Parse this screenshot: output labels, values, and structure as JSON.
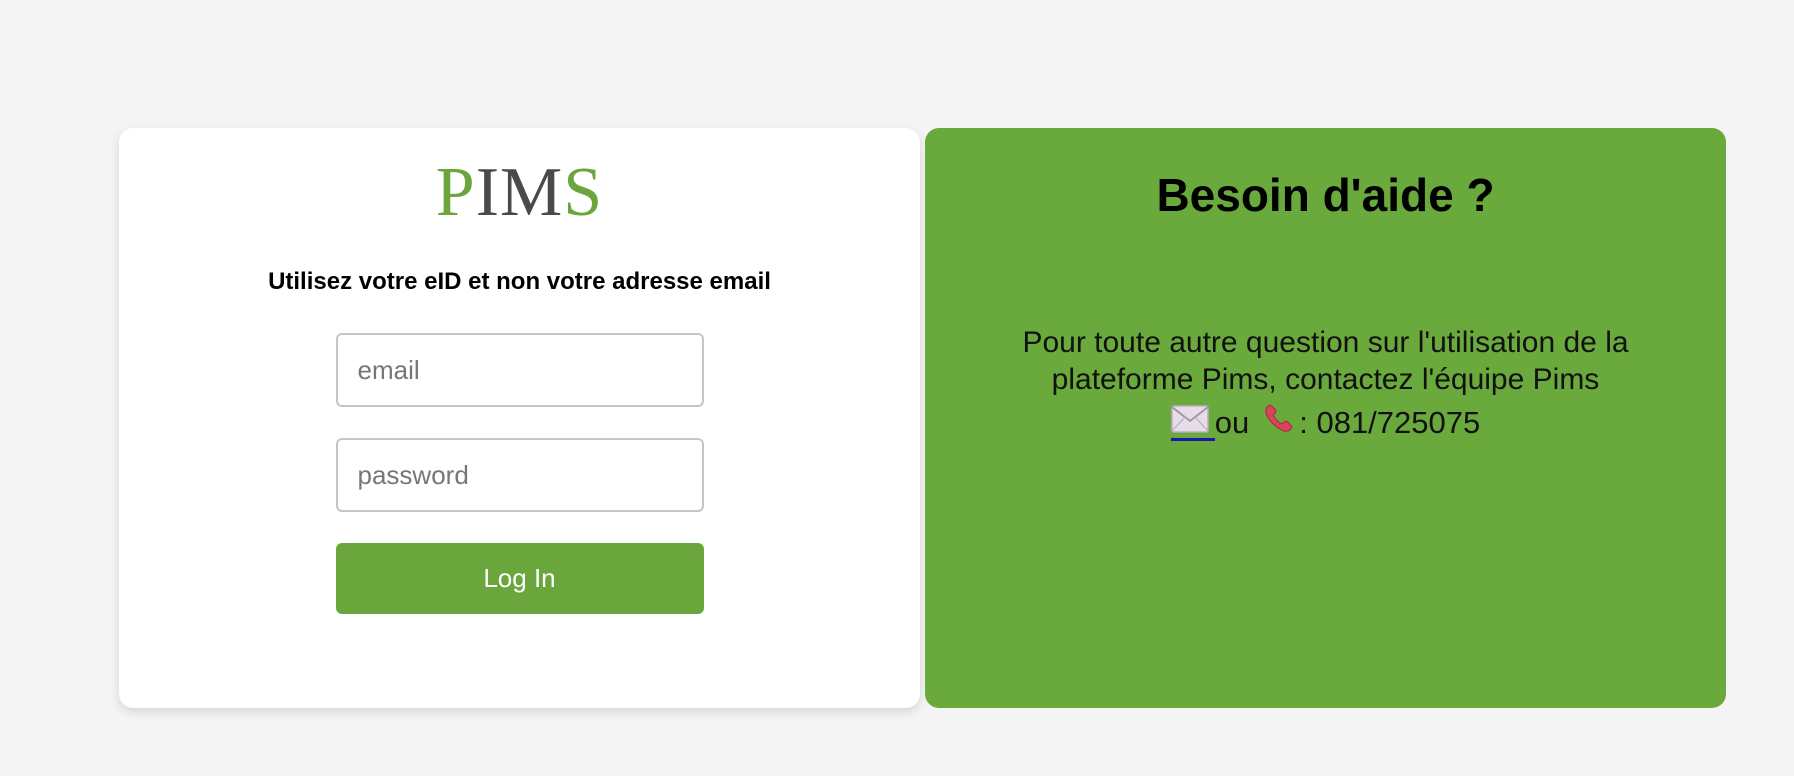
{
  "login": {
    "logo": {
      "letters": [
        "P",
        "I",
        "M",
        "S"
      ],
      "brand_color": "#6aa63c",
      "dark_color": "#4a4a4a"
    },
    "subtitle": "Utilisez votre eID et non votre adresse email",
    "email_placeholder": "email",
    "email_value": "",
    "password_placeholder": "password",
    "password_value": "",
    "login_label": "Log In"
  },
  "help": {
    "title": "Besoin d'aide ?",
    "text": "Pour toute autre question sur l'utilisation de la plateforme Pims, contactez l'équipe Pims",
    "mail_icon": "envelope-icon",
    "or_label": "ou",
    "phone_icon": "phone-icon",
    "phone_label": ": 081/725075",
    "background_color": "#6aa93c"
  }
}
